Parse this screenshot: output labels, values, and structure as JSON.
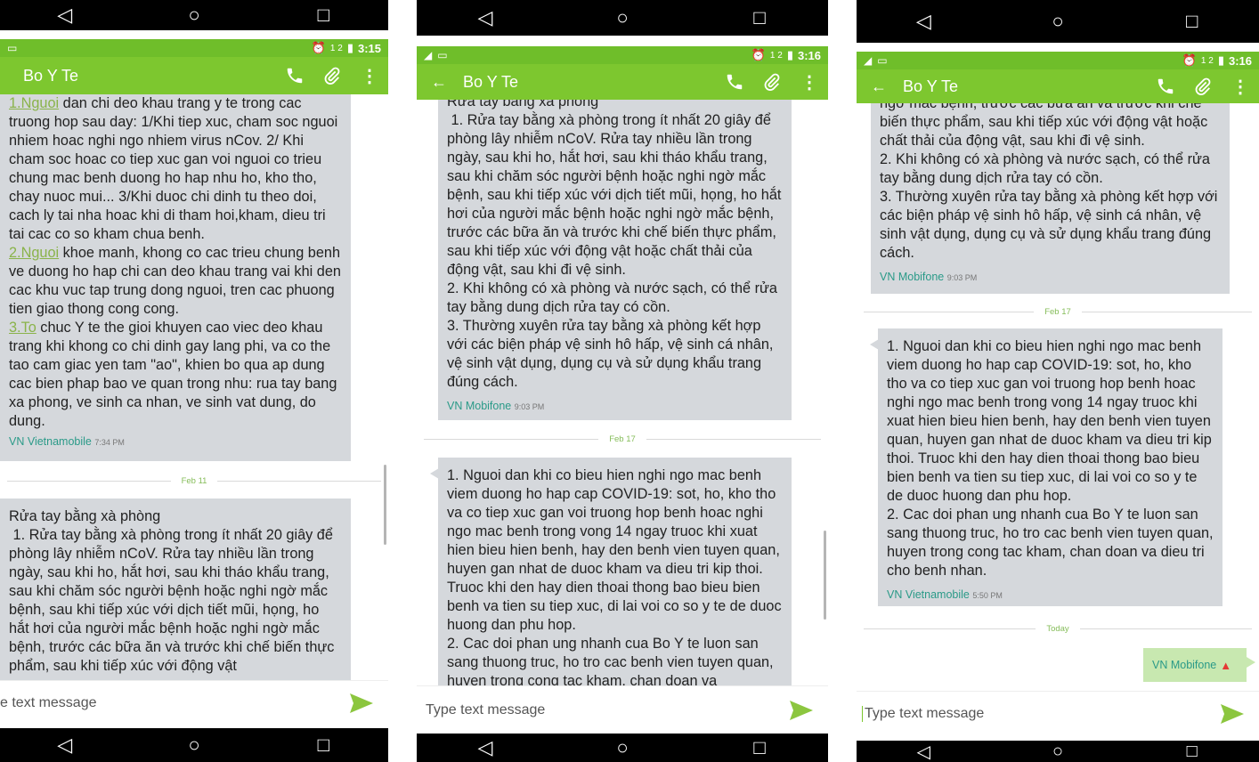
{
  "nav": {
    "back_glyph": "◁",
    "home_glyph": "○",
    "recent_glyph": "□"
  },
  "status": {
    "time1": "3:15",
    "time2": "3:16",
    "time3": "3:16",
    "signal": "1 2"
  },
  "appbar": {
    "title": "Bo Y Te"
  },
  "dates": {
    "feb11": "Feb 11",
    "feb17": "Feb 17",
    "today": "Today"
  },
  "composer": {
    "placeholder": "Type text message",
    "cut_placeholder": "e text message"
  },
  "panel1": {
    "msg1": {
      "l1_link": "1.Nguoi",
      "l1_rest": " dan chi deo khau trang y te trong cac truong hop sau day: 1/Khi tiep xuc, cham soc nguoi nhiem hoac nghi ngo nhiem virus nCov. 2/ Khi cham soc hoac co tiep xuc gan voi nguoi co trieu chung mac benh duong ho hap nhu ho, kho tho, chay nuoc mui... 3/Khi duoc chi dinh tu theo doi, cach ly tai nha hoac khi di tham hoi,kham, dieu tri tai cac co so kham chua benh.",
      "l2_link": "2.Nguoi",
      "l2_rest": " khoe manh, khong co cac trieu chung benh ve duong ho hap chi can deo khau trang vai khi den cac khu vuc tap trung dong nguoi, tren cac phuong tien giao thong cong cong.",
      "l3_link": "3.To",
      "l3_rest": " chuc Y te the gioi khuyen cao viec deo khau trang khi khong co chi dinh gay lang phi, va co the tao cam giac yen tam \"ao\", khien bo qua ap dung cac bien phap bao ve quan trong nhu: rua tay bang xa phong, ve sinh ca nhan, ve sinh vat dung, do dung.",
      "sender": "VN Vietnamobile",
      "time": "7:34 PM"
    },
    "msg2": {
      "text": "Rửa tay bằng xà phòng\n 1. Rửa tay bằng xà phòng trong ít nhất 20 giây để phòng lây nhiễm nCoV. Rửa tay nhiều lần trong ngày, sau khi ho, hắt hơi, sau khi tháo khẩu trang, sau khi chăm sóc người bệnh hoặc nghi ngờ mắc bệnh, sau khi tiếp xúc với dịch tiết mũi, họng, ho hắt hơi của người mắc bệnh hoặc nghi ngờ mắc bệnh, trước các bữa ăn và trước khi chế biến thực phẩm, sau khi tiếp xúc với động vật"
    }
  },
  "panel2": {
    "msg1": {
      "text": "Rửa tay bằng xà phòng\n 1. Rửa tay bằng xà phòng trong ít nhất 20 giây để phòng lây nhiễm nCoV. Rửa tay nhiều lần trong ngày, sau khi ho, hắt hơi, sau khi tháo khẩu trang, sau khi chăm sóc người bệnh hoặc nghi ngờ mắc bệnh, sau khi tiếp xúc với dịch tiết mũi, họng, ho hắt hơi của người mắc bệnh hoặc nghi ngờ mắc bệnh, trước các bữa ăn và trước khi chế biến thực phẩm, sau khi tiếp xúc với động vật hoặc chất thải của động vật, sau khi đi vệ sinh.\n2. Khi không có xà phòng và nước sạch, có thể rửa tay bằng dung dịch rửa tay có cồn.\n3. Thường xuyên rửa tay bằng xà phòng kết hợp với các biện pháp vệ sinh hô hấp, vệ sinh cá nhân, vệ sinh vật dụng, dụng cụ và sử dụng khẩu trang đúng cách.",
      "sender": "VN Mobifone",
      "time": "9:03 PM"
    },
    "msg2": {
      "text": "1. Nguoi dan khi co bieu hien nghi ngo mac benh viem duong ho hap cap COVID-19: sot, ho, kho tho va co tiep xuc gan voi truong hop benh hoac nghi ngo mac benh trong vong 14 ngay truoc khi xuat hien bieu hien benh, hay den benh vien tuyen quan, huyen gan nhat de duoc kham va dieu tri kip thoi. Truoc khi den hay dien thoai thong bao bieu bien benh va tien su tiep xuc, di lai voi co so y te de duoc huong dan phu hop.\n2. Cac doi phan ung nhanh cua Bo Y te luon san sang thuong truc, ho tro cac benh vien tuyen quan, huyen trong cong tac kham, chan doan va"
    }
  },
  "panel3": {
    "msg1": {
      "text": "ngờ mắc bệnh, trước các bữa ăn và trước khi chế biến thực phẩm, sau khi tiếp xúc với động vật hoặc chất thải của động vật, sau khi đi vệ sinh.\n2. Khi không có xà phòng và nước sạch, có thể rửa tay bằng dung dịch rửa tay có cồn.\n3. Thường xuyên rửa tay bằng xà phòng kết hợp với các biện pháp vệ sinh hô hấp, vệ sinh cá nhân, vệ sinh vật dụng, dụng cụ và sử dụng khẩu trang đúng cách.",
      "sender": "VN Mobifone",
      "time": "9:03 PM"
    },
    "msg2": {
      "text": "1. Nguoi dan khi co bieu hien nghi ngo mac benh viem duong ho hap cap COVID-19: sot, ho, kho tho va co tiep xuc gan voi truong hop benh hoac nghi ngo mac benh trong vong 14 ngay truoc khi xuat hien bieu hien benh, hay den benh vien tuyen quan, huyen gan nhat de duoc kham va dieu tri kip thoi. Truoc khi den hay dien thoai thong bao bieu bien benh va tien su tiep xuc, di lai voi co so y te de duoc huong dan phu hop.\n2. Cac doi phan ung nhanh cua Bo Y te luon san sang thuong truc, ho tro cac benh vien tuyen quan, huyen trong cong tac kham, chan doan va dieu tri cho benh nhan.",
      "sender": "VN Vietnamobile",
      "time": "5:50 PM"
    },
    "sent": {
      "label": "VN Mobifone"
    }
  },
  "colors": {
    "status_bar": "#6fbe2a",
    "app_bar": "#7dc72f",
    "bubble": "#d5d8dc",
    "sender": "#2a9a88",
    "send_arrow": "#8cc63f",
    "warning": "#e53935"
  }
}
